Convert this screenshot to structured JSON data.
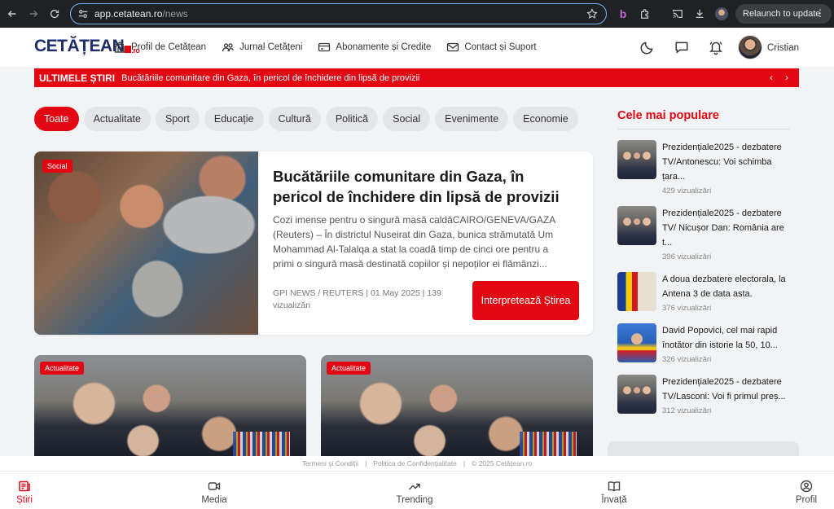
{
  "browser": {
    "url_host": "app.cetatean.ro",
    "url_path": "/news",
    "relaunch_label": "Relaunch to update"
  },
  "header": {
    "logo_main": "CETĂȚEAN",
    "logo_suffix": ".ro",
    "nav": [
      {
        "label": "Profil de Cetățean",
        "icon": "building-icon"
      },
      {
        "label": "Jurnal Cetățeni",
        "icon": "people-icon"
      },
      {
        "label": "Abonamente și Credite",
        "icon": "card-icon"
      },
      {
        "label": "Contact și Suport",
        "icon": "mail-icon"
      }
    ],
    "user_name": "Cristian"
  },
  "ticker": {
    "label": "ULTIMELE ȘTIRI",
    "text": "Bucătăriile comunitare din Gaza, în pericol de închidere din lipsă de provizii"
  },
  "categories": [
    "Toate",
    "Actualitate",
    "Sport",
    "Educație",
    "Cultură",
    "Politică",
    "Social",
    "Evenimente",
    "Economie"
  ],
  "featured": {
    "badge": "Social",
    "title": "Bucătăriile comunitare din Gaza, în pericol de închidere din lipsă de provizii",
    "description": "Cozi imense pentru o singură masă caldăCAIRO/GENEVA/GAZA (Reuters) – În districtul Nuseirat din Gaza, bunica strămutată Um Mohammad Al-Talalqa a stat la coadă timp de cinci ore pentru a primi o singură masă destinată copiilor și nepoților ei flămânzi...",
    "meta": "GPI NEWS / REUTERS | 01 May 2025 | 139 vizualizări",
    "cta": "Interpretează Știrea"
  },
  "grid_cards": [
    {
      "badge": "Actualitate"
    },
    {
      "badge": "Actualitate"
    }
  ],
  "sidebar": {
    "title": "Cele mai populare",
    "items": [
      {
        "title": "Prezidențiale2025 - dezbatere TV/Antonescu: Voi schimba țara...",
        "views": "429 vizualizări"
      },
      {
        "title": "Prezidențiale2025 - dezbatere TV/ Nicușor Dan: România are t...",
        "views": "396 vizualizări"
      },
      {
        "title": "A doua dezbatere electorala, la Antena 3 de data asta.",
        "views": "376 vizualizări"
      },
      {
        "title": "David Popovici, cel mai rapid înotător din istorie la 50, 10...",
        "views": "326 vizualizări"
      },
      {
        "title": "Prezidențiale2025 - dezbatere TV/Lasconi: Voi fi primul preș...",
        "views": "312 vizualizări"
      }
    ]
  },
  "footer": {
    "terms": "Termeni și Condiții",
    "privacy": "Politica de Confidențialitate",
    "copyright": "© 2025 Cetățean.ro"
  },
  "bottom_nav": [
    {
      "label": "Știri",
      "icon": "news-icon"
    },
    {
      "label": "Media",
      "icon": "video-icon"
    },
    {
      "label": "Trending",
      "icon": "trending-icon"
    },
    {
      "label": "Învață",
      "icon": "book-icon"
    },
    {
      "label": "Profil",
      "icon": "user-icon"
    }
  ],
  "colors": {
    "accent": "#e30613",
    "brand_blue": "#1d2d6b"
  }
}
